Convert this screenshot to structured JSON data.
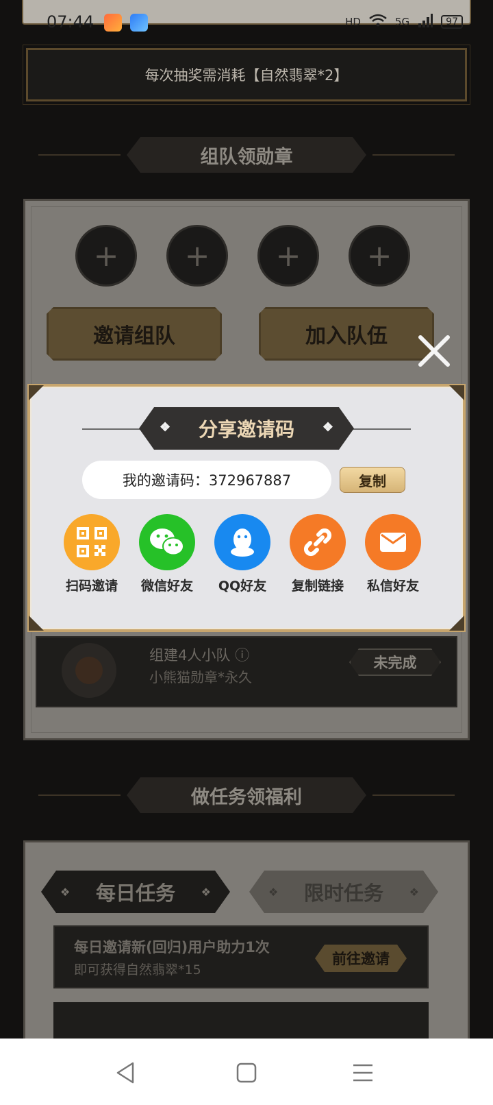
{
  "status_bar": {
    "time": "07:44",
    "hd": "HD",
    "network": "5G",
    "battery": "97"
  },
  "cost_banner": "每次抽奖需消耗【自然翡翠*2】",
  "team_section": {
    "title": "组队领勋章",
    "slot_symbol": "+",
    "invite_team_button": "邀请组队",
    "join_team_button": "加入队伍",
    "reward": {
      "title": "组建4人小队",
      "subtitle": "小熊猫勋章*永久",
      "status": "未完成"
    }
  },
  "share_dialog": {
    "title": "分享邀请码",
    "code_label": "我的邀请码：372967887",
    "copy_button": "复制",
    "options": [
      {
        "label": "扫码邀请",
        "icon": "qr-code-icon",
        "color": "#f9a82a"
      },
      {
        "label": "微信好友",
        "icon": "wechat-icon",
        "color": "#26c128"
      },
      {
        "label": "QQ好友",
        "icon": "qq-icon",
        "color": "#1889f0"
      },
      {
        "label": "复制链接",
        "icon": "link-icon",
        "color": "#f57a26"
      },
      {
        "label": "私信好友",
        "icon": "mail-icon",
        "color": "#f57a26"
      }
    ]
  },
  "task_section": {
    "title": "做任务领福利",
    "tabs": [
      "每日任务",
      "限时任务"
    ],
    "task": {
      "title": "每日邀请新(回归)用户助力1次",
      "subtitle": "即可获得自然翡翠*15",
      "action": "前往邀请"
    }
  },
  "colors": {
    "dialog_border": "#c7a56d",
    "title_text": "#ecd7b5"
  }
}
